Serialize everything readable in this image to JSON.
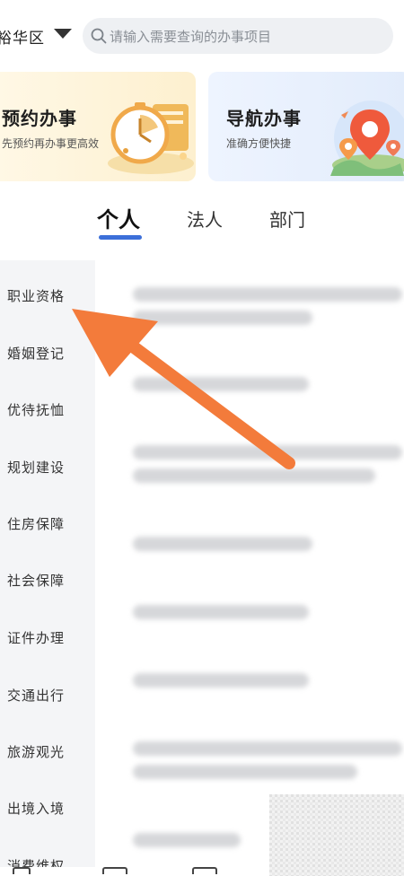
{
  "header": {
    "district": "裕华区",
    "search_placeholder": "请输入需要查询的办事项目"
  },
  "cards": [
    {
      "title": "预约办事",
      "subtitle": "先预约再办事更高效"
    },
    {
      "title": "导航办事",
      "subtitle": "准确方便快捷"
    }
  ],
  "tabs": [
    {
      "label": "个人",
      "active": true
    },
    {
      "label": "法人",
      "active": false
    },
    {
      "label": "部门",
      "active": false
    }
  ],
  "sidebar": {
    "items": [
      {
        "label": "职业资格"
      },
      {
        "label": "婚姻登记"
      },
      {
        "label": "优待抚恤"
      },
      {
        "label": "规划建设"
      },
      {
        "label": "住房保障"
      },
      {
        "label": "社会保障"
      },
      {
        "label": "证件办理"
      },
      {
        "label": "交通出行"
      },
      {
        "label": "旅游观光"
      },
      {
        "label": "出境入境"
      },
      {
        "label": "消费维权"
      }
    ]
  },
  "colors": {
    "accent": "#3c6fd9",
    "arrow": "#f37b3b",
    "sidebar_bg": "#f4f5f7",
    "search_bg": "#eef0f3"
  }
}
